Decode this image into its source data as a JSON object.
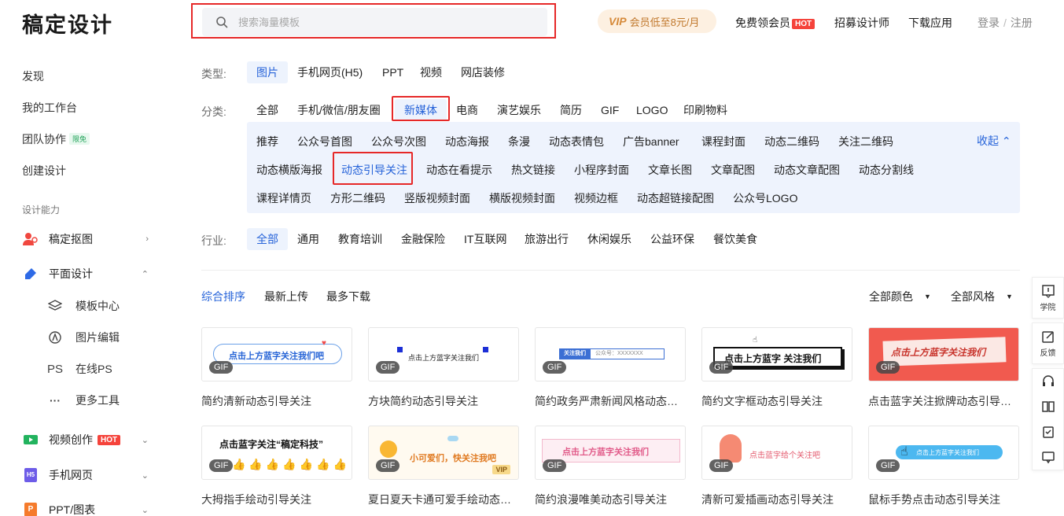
{
  "header": {
    "logo": "稿定设计",
    "search_placeholder": "搜索海量模板",
    "vip_icon": "VIP",
    "vip_text": "会员低至8元/月",
    "free_member": "免费领会员",
    "hot": "HOT",
    "recruit": "招募设计师",
    "download": "下载应用",
    "login": "登录",
    "sep": "/",
    "register": "注册"
  },
  "sidebar": {
    "discover": "发现",
    "workspace": "我的工作台",
    "team": "团队协作",
    "team_tag": "限免",
    "create": "创建设计",
    "section": "设计能力",
    "cutout": "稿定抠图",
    "graphic": "平面设计",
    "template_center": "模板中心",
    "image_edit": "图片编辑",
    "ps_icon": "PS",
    "online_ps": "在线PS",
    "more_icon": "···",
    "more_tools": "更多工具",
    "video": "视频创作",
    "video_hot": "HOT",
    "h5_icon": "H5",
    "h5": "手机网页",
    "ppt_icon": "P",
    "ppt": "PPT/图表"
  },
  "filters": {
    "type_label": "类型:",
    "types": [
      "图片",
      "手机网页(H5)",
      "PPT",
      "视频",
      "网店装修"
    ],
    "cat_label": "分类:",
    "cats": [
      "全部",
      "手机/微信/朋友圈",
      "新媒体",
      "电商",
      "演艺娱乐",
      "简历",
      "GIF",
      "LOGO",
      "印刷物料"
    ],
    "subs_row1": [
      "推荐",
      "公众号首图",
      "公众号次图",
      "动态海报",
      "条漫",
      "动态表情包",
      "广告banner",
      "课程封面",
      "动态二维码",
      "关注二维码"
    ],
    "subs_row2": [
      "动态横版海报",
      "动态引导关注",
      "动态在看提示",
      "热文链接",
      "小程序封面",
      "文章长图",
      "文章配图",
      "动态文章配图",
      "动态分割线"
    ],
    "subs_row3": [
      "课程详情页",
      "方形二维码",
      "竖版视频封面",
      "横版视频封面",
      "视频边框",
      "动态超链接配图",
      "公众号LOGO"
    ],
    "collapse": "收起 ⌃",
    "industry_label": "行业:",
    "industries": [
      "全部",
      "通用",
      "教育培训",
      "金融保险",
      "IT互联网",
      "旅游出行",
      "休闲娱乐",
      "公益环保",
      "餐饮美食"
    ]
  },
  "sort": {
    "items": [
      "综合排序",
      "最新上传",
      "最多下载"
    ],
    "color": "全部颜色",
    "style": "全部风格"
  },
  "cards": [
    {
      "title": "简约清新动态引导关注",
      "banner": "点击上方蓝字关注我们吧",
      "badge": "GIF"
    },
    {
      "title": "方块简约动态引导关注",
      "banner": "点击上方蓝字关注我们",
      "badge": "GIF"
    },
    {
      "title": "简约政务严肃新闻风格动态引导关注",
      "banner": "关注我们",
      "banner2": "公众号：XXXXXXX",
      "badge": "GIF"
    },
    {
      "title": "简约文字框动态引导关注",
      "banner": "点击上方蓝字 关注我们",
      "badge": "GIF"
    },
    {
      "title": "点击蓝字关注掀牌动态引导关注",
      "banner": "点击上方蓝字关注我们",
      "badge": "GIF"
    },
    {
      "title": "大拇指手绘动引导关注",
      "banner": "点击蓝字关注“稿定科技”",
      "badge": "GIF"
    },
    {
      "title": "夏日夏天卡通可爱手绘动态引导关注",
      "banner": "小可爱们，快关注我吧",
      "badge": "GIF",
      "vip": "VIP"
    },
    {
      "title": "简约浪漫唯美动态引导关注",
      "banner": "点击上方蓝字关注我们",
      "badge": "GIF"
    },
    {
      "title": "清新可爱插画动态引导关注",
      "banner": "点击蓝字给个关注吧",
      "badge": "GIF"
    },
    {
      "title": "鼠标手势点击动态引导关注",
      "banner": "点击上方蓝字关注我们",
      "badge": "GIF"
    }
  ],
  "floatbar": {
    "school": "学院",
    "feedback": "反馈"
  }
}
